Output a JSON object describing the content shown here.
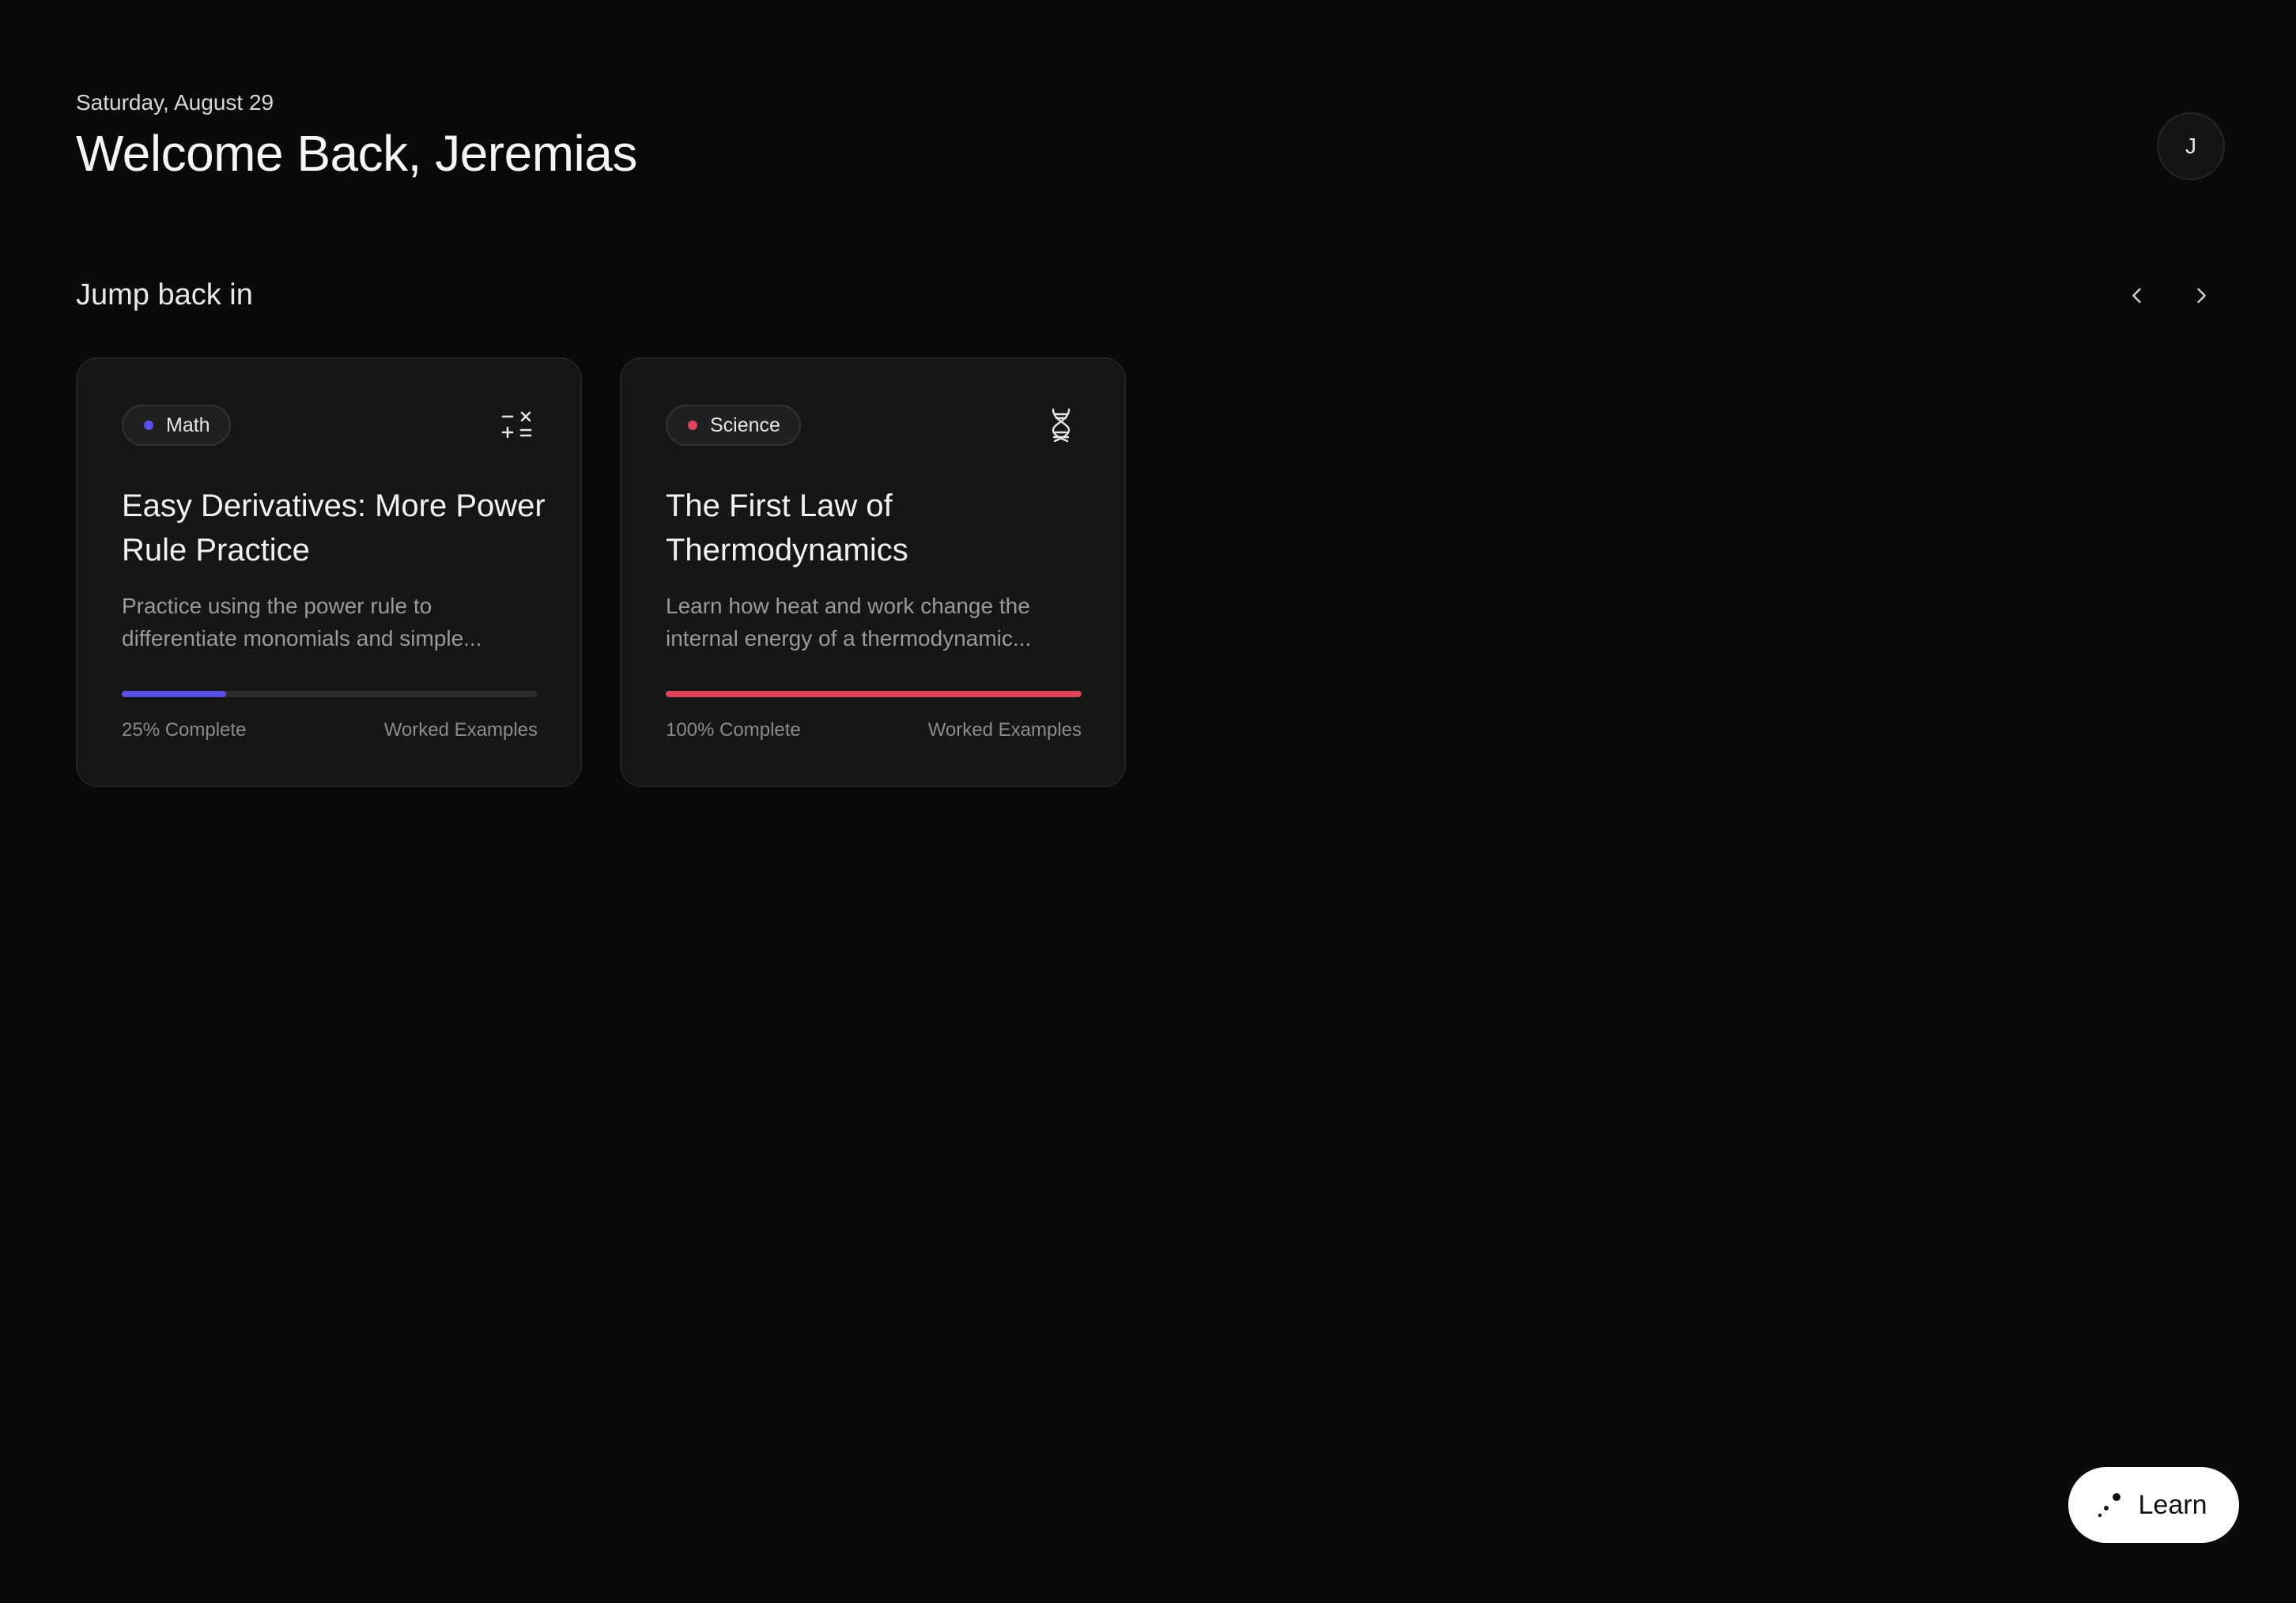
{
  "header": {
    "date": "Saturday, August 29",
    "welcome": "Welcome Back, Jeremias",
    "avatar_initial": "J"
  },
  "section": {
    "title": "Jump back in",
    "prev_icon": "chevron-left-icon",
    "next_icon": "chevron-right-icon"
  },
  "cards": [
    {
      "tag": "Math",
      "tag_color": "#5b50e6",
      "icon": "math-operators-icon",
      "title": "Easy Derivatives: More Power Rule Practice",
      "description": "Practice using the power rule to differentiate monomials and simple...",
      "progress_percent": 25,
      "progress_label": "25% Complete",
      "type_label": "Worked Examples",
      "accent": "#5b50e6"
    },
    {
      "tag": "Science",
      "tag_color": "#e0435b",
      "icon": "dna-icon",
      "title": "The First Law of Thermodynamics",
      "description": "Learn how heat and work change the internal energy of a thermodynamic...",
      "progress_percent": 100,
      "progress_label": "100% Complete",
      "type_label": "Worked Examples",
      "accent": "#e0435b"
    }
  ],
  "learn_button": {
    "label": "Learn",
    "icon": "sparkle-dots-icon"
  }
}
